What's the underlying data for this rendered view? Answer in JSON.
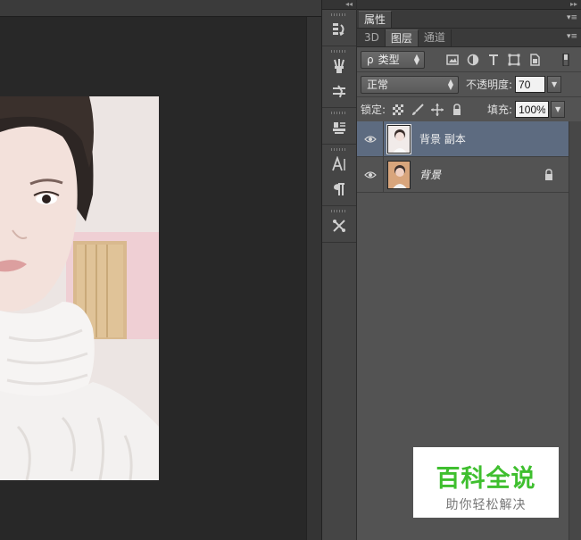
{
  "properties_panel": {
    "tab": "属性"
  },
  "layers_panel": {
    "tabs": [
      "3D",
      "图层",
      "通道"
    ],
    "active_tab_index": 1,
    "filter": {
      "kind_label": "类型",
      "kind_prefix": "ρ"
    },
    "blend_mode": "正常",
    "opacity_label": "不透明度:",
    "opacity_value": "70",
    "lock_label": "锁定:",
    "fill_label": "填充:",
    "fill_value": "100%",
    "layers": [
      {
        "name": "背景 副本",
        "visible": true,
        "selected": true,
        "locked": false
      },
      {
        "name": "背景",
        "visible": true,
        "selected": false,
        "locked": true
      }
    ]
  },
  "tool_strip": {
    "icons": [
      "history-icon",
      "brush-preset-icon",
      "brush-settings-icon",
      "clone-source-icon",
      "character-icon",
      "paragraph-icon",
      "tool-presets-icon"
    ]
  },
  "watermark": {
    "title": "百科全说",
    "subtitle": "助你轻松解决"
  },
  "colors": {
    "panel_bg": "#535353",
    "selected_layer": "#5d6b80",
    "canvas_bg": "#282828",
    "watermark_green": "#3fbf2f"
  }
}
